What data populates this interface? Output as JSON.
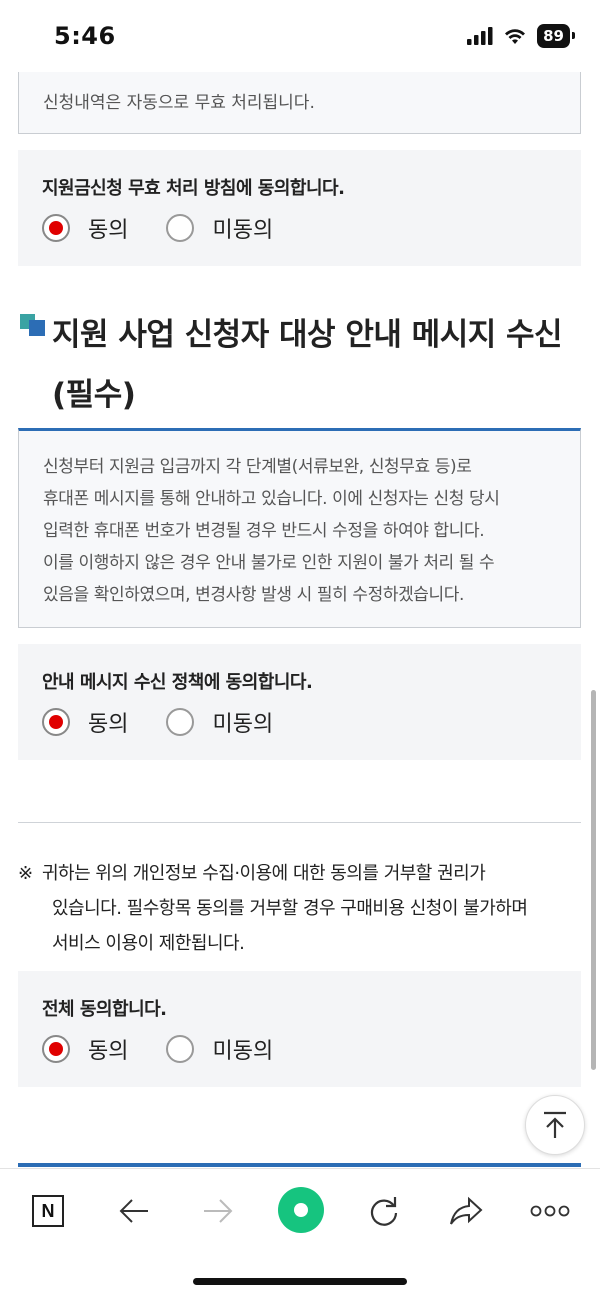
{
  "status_bar": {
    "time": "5:46",
    "battery": "89"
  },
  "top_notice": {
    "last_line": "신청내역은 자동으로 무효 처리됩니다."
  },
  "consent_invalid": {
    "question": "지원금신청 무효 처리 방침에 동의합니다.",
    "agree_label": "동의",
    "disagree_label": "미동의",
    "selected": "agree"
  },
  "section": {
    "title": "지원 사업 신청자 대상 안내 메시지 수신 (필수)"
  },
  "notice": {
    "lines": [
      "신청부터 지원금 입금까지 각 단계별(서류보완, 신청무효 등)로",
      "휴대폰 메시지를 통해 안내하고 있습니다. 이에 신청자는 신청 당시",
      "입력한 휴대폰 번호가 변경될 경우 반드시 수정을 하여야 합니다.",
      "이를 이행하지 않은 경우 안내 불가로 인한 지원이 불가 처리 될 수",
      "있음을 확인하였으며, 변경사항 발생 시 필히 수정하겠습니다."
    ]
  },
  "consent_message": {
    "question": "안내 메시지 수신 정책에 동의합니다.",
    "agree_label": "동의",
    "disagree_label": "미동의",
    "selected": "agree"
  },
  "disclaimer": {
    "mark": "※",
    "line1": "귀하는 위의 개인정보 수집·이용에 대한 동의를 거부할 권리가",
    "line2": "있습니다. 필수항목 동의를 거부할 경우 구매비용 신청이 불가하며",
    "line3": "서비스 이용이 제한됩니다."
  },
  "consent_all": {
    "question": "전체 동의합니다.",
    "agree_label": "동의",
    "disagree_label": "미동의",
    "selected": "agree"
  },
  "toolbar": {
    "n_label": "N"
  },
  "colors": {
    "accent_blue": "#2c6db5",
    "radio_red": "#e00000",
    "green": "#16c47f"
  }
}
